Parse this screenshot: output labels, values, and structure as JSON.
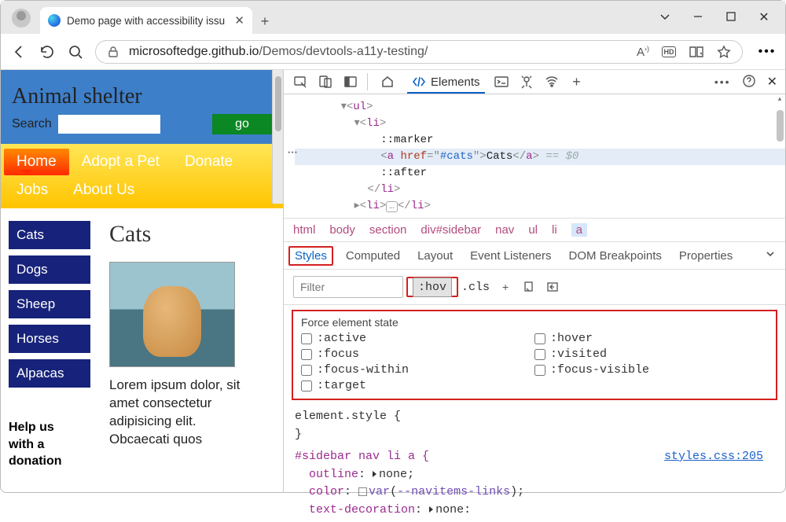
{
  "window": {
    "tab_title": "Demo page with accessibility issu"
  },
  "addressbar": {
    "host": "microsoftedge.github.io",
    "path": "/Demos/devtools-a11y-testing/",
    "reader_icon": "A))",
    "hd": "HD"
  },
  "page": {
    "title": "Animal shelter",
    "search_label": "Search",
    "go": "go",
    "nav": [
      "Home",
      "Adopt a Pet",
      "Donate",
      "Jobs",
      "About Us"
    ],
    "sidebar": [
      "Cats",
      "Dogs",
      "Sheep",
      "Horses",
      "Alpacas"
    ],
    "help": [
      "Help us",
      "with a",
      "donation"
    ],
    "h2": "Cats",
    "lorem": "Lorem ipsum dolor, sit amet consectetur adipisicing elit. Obcaecati quos"
  },
  "devtools": {
    "tabs": {
      "elements": "Elements"
    },
    "dom": {
      "ul": "ul",
      "li": "li",
      "marker": "::marker",
      "a": "a",
      "href_attr": "href",
      "href_val": "#cats",
      "text": "Cats",
      "after": "::after",
      "eq": "== $0",
      "badge": "…"
    },
    "crumbs": [
      "html",
      "body",
      "section",
      "div#sidebar",
      "nav",
      "ul",
      "li",
      "a"
    ],
    "styles_tabs": [
      "Styles",
      "Computed",
      "Layout",
      "Event Listeners",
      "DOM Breakpoints",
      "Properties"
    ],
    "filter_placeholder": "Filter",
    "hov": ":hov",
    "cls": ".cls",
    "force": {
      "title": "Force element state",
      "states": [
        ":active",
        ":hover",
        ":focus",
        ":visited",
        ":focus-within",
        ":focus-visible",
        ":target"
      ]
    },
    "rules": {
      "elstyle": "element.style {",
      "close": "}",
      "sel": "#sidebar nav li a {",
      "outline": "outline",
      "none": "none",
      "color": "color",
      "var": "var",
      "varname": "--navitems-links",
      "td": "text-decoration",
      "src": "styles.css:205"
    }
  }
}
